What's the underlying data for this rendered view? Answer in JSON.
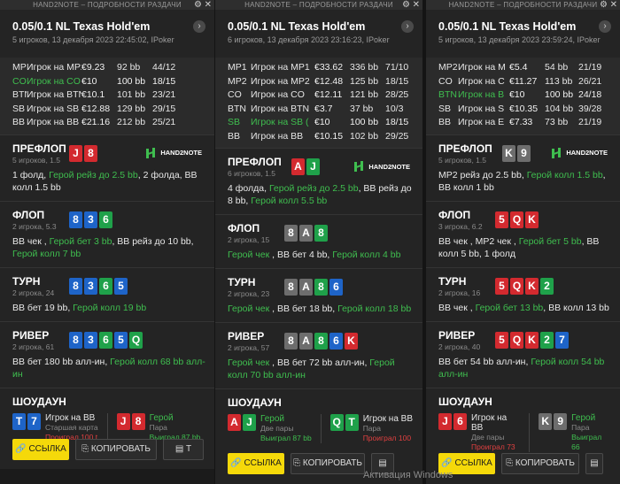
{
  "title_bar": "HAND2NOTE – ПОДРОБНОСТИ РАЗДАЧИ",
  "watermark": "Активация Windows",
  "logo_text": "HAND2NOTE",
  "labels": {
    "preflop": "ПРЕФЛОП",
    "flop": "ФЛОП",
    "turn": "ТУРН",
    "river": "РИВЕР",
    "showdown": "ШОУДАУН",
    "link": "ССЫЛКА",
    "copy": "КОПИРОВАТЬ"
  },
  "windows": [
    {
      "game": "0.05/0.1 NL Texas Hold'em",
      "sub": "5 игроков, 13 декабря 2023 22:45:02, IPoker",
      "players": [
        {
          "pos": "MP2",
          "name": "Игрок на MP2",
          "amt": "€9.23",
          "bb": "92 bb",
          "stat": "44/12"
        },
        {
          "pos": "CO",
          "name": "Игрок на CO (П",
          "amt": "€10",
          "bb": "100 bb",
          "stat": "18/15"
        },
        {
          "pos": "BTN",
          "name": "Игрок на BTN",
          "amt": "€10.1",
          "bb": "101 bb",
          "stat": "23/21"
        },
        {
          "pos": "SB",
          "name": "Игрок на SB",
          "amt": "€12.88",
          "bb": "129 bb",
          "stat": "29/15"
        },
        {
          "pos": "BB",
          "name": "Игрок на BB",
          "amt": "€21.16",
          "bb": "212 bb",
          "stat": "25/21"
        }
      ],
      "preflop": {
        "sub": "5 игроков, 1.5",
        "cards": [
          {
            "r": "J",
            "c": "red"
          },
          {
            "r": "8",
            "c": "red"
          }
        ],
        "a1": "1 фолд, ",
        "a2": "Герой рейз до 2.5 bb",
        "a3": ", 2 фолда, BB ",
        "a4": "колл",
        "a5": " 1.5 bb"
      },
      "flop": {
        "sub": "2 игрока, 5.3",
        "cards": [
          {
            "r": "8",
            "c": "blue"
          },
          {
            "r": "3",
            "c": "blue"
          },
          {
            "r": "6",
            "c": "grn"
          }
        ],
        "a1": "BB чек , ",
        "a2": "Герой бет 3 bb",
        "a3": ", BB рейз до 10 bb, ",
        "a4": "Герой колл 7 bb"
      },
      "turn": {
        "sub": "2 игрока, 24",
        "cards": [
          {
            "r": "8",
            "c": "blue"
          },
          {
            "r": "3",
            "c": "blue"
          },
          {
            "r": "6",
            "c": "grn"
          },
          {
            "r": "5",
            "c": "blue"
          }
        ],
        "a1": "BB бет 19 bb, ",
        "a2": "Герой колл 19 bb"
      },
      "river": {
        "sub": "2 игрока, 61",
        "cards": [
          {
            "r": "8",
            "c": "blue"
          },
          {
            "r": "3",
            "c": "blue"
          },
          {
            "r": "6",
            "c": "grn"
          },
          {
            "r": "5",
            "c": "blue"
          },
          {
            "r": "Q",
            "c": "grn"
          }
        ],
        "a1": "BB бет 180 bb алл-ин, ",
        "a2": "Герой колл 68 bb алл-ин"
      },
      "sd": [
        {
          "cards": [
            {
              "r": "T",
              "c": "blue"
            },
            {
              "r": "7",
              "c": "blue"
            }
          ],
          "name": "Игрок на BB",
          "hand": "Старшая карта",
          "res": "Проиграл 100 t",
          "win": false
        },
        {
          "cards": [
            {
              "r": "J",
              "c": "red"
            },
            {
              "r": "8",
              "c": "red"
            }
          ],
          "name": "Герой",
          "hand": "Пара",
          "res": "Выиграл 87 bb",
          "win": true
        }
      ],
      "third_btn": "T"
    },
    {
      "game": "0.05/0.1 NL Texas Hold'em",
      "sub": "6 игроков, 13 декабря 2023 23:16:23, IPoker",
      "players": [
        {
          "pos": "MP1",
          "name": "Игрок на MP1",
          "amt": "€33.62",
          "bb": "336 bb",
          "stat": "71/10"
        },
        {
          "pos": "MP2",
          "name": "Игрок на MP2",
          "amt": "€12.48",
          "bb": "125 bb",
          "stat": "18/15"
        },
        {
          "pos": "CO",
          "name": "Игрок на CO",
          "amt": "€12.11",
          "bb": "121 bb",
          "stat": "28/25"
        },
        {
          "pos": "BTN",
          "name": "Игрок на BTN",
          "amt": "€3.7",
          "bb": "37 bb",
          "stat": "10/3"
        },
        {
          "pos": "SB",
          "name": "Игрок на SB (",
          "amt": "€10",
          "bb": "100 bb",
          "stat": "18/15"
        },
        {
          "pos": "BB",
          "name": "Игрок на BB",
          "amt": "€10.15",
          "bb": "102 bb",
          "stat": "29/25"
        }
      ],
      "preflop": {
        "sub": "6 игроков, 1.5",
        "cards": [
          {
            "r": "A",
            "c": "red"
          },
          {
            "r": "J",
            "c": "grn"
          }
        ],
        "a1": "4 фолда, ",
        "a2": "Герой рейз до 2.5 bb",
        "a3": ", BB рейз до 8 bb, ",
        "a4": "Герой колл 5.5 bb",
        "a5": ""
      },
      "flop": {
        "sub": "2 игрока, 15",
        "cards": [
          {
            "r": "8",
            "c": "gray"
          },
          {
            "r": "A",
            "c": "gray"
          },
          {
            "r": "8",
            "c": "grn"
          }
        ],
        "a1": "",
        "a2": "Герой чек",
        "a3": " , BB бет 4 bb, ",
        "a4": "Герой колл 4 bb"
      },
      "turn": {
        "sub": "2 игрока, 23",
        "cards": [
          {
            "r": "8",
            "c": "gray"
          },
          {
            "r": "A",
            "c": "gray"
          },
          {
            "r": "8",
            "c": "grn"
          },
          {
            "r": "6",
            "c": "blue"
          }
        ],
        "a1": "",
        "a2": "Герой чек",
        "a3": " , BB бет 18 bb, ",
        "a4": "Герой колл 18 bb"
      },
      "river": {
        "sub": "2 игрока, 57",
        "cards": [
          {
            "r": "8",
            "c": "gray"
          },
          {
            "r": "A",
            "c": "gray"
          },
          {
            "r": "8",
            "c": "grn"
          },
          {
            "r": "6",
            "c": "blue"
          },
          {
            "r": "K",
            "c": "red"
          }
        ],
        "a1": "",
        "a2": "Герой чек",
        "a3": " , BB бет 72 bb алл-ин, ",
        "a4": "Герой колл 70 bb алл-ин"
      },
      "sd": [
        {
          "cards": [
            {
              "r": "A",
              "c": "red"
            },
            {
              "r": "J",
              "c": "grn"
            }
          ],
          "name": "Герой",
          "hand": "Две пары",
          "res": "Выиграл 87 bb",
          "win": true
        },
        {
          "cards": [
            {
              "r": "Q",
              "c": "grn"
            },
            {
              "r": "T",
              "c": "grn"
            }
          ],
          "name": "Игрок на BB",
          "hand": "Пара",
          "res": "Проиграл 100",
          "win": false
        }
      ],
      "third_btn": ""
    },
    {
      "game": "0.05/0.1 NL Texas Hold'em",
      "sub": "5 игроков, 13 декабря 2023 23:59:24, IPoker",
      "players": [
        {
          "pos": "MP2",
          "name": "Игрок на M",
          "amt": "€5.4",
          "bb": "54 bb",
          "stat": "21/19"
        },
        {
          "pos": "CO",
          "name": "Игрок на С",
          "amt": "€11.27",
          "bb": "113 bb",
          "stat": "26/21"
        },
        {
          "pos": "BTN",
          "name": "Игрок на B",
          "amt": "€10",
          "bb": "100 bb",
          "stat": "24/18"
        },
        {
          "pos": "SB",
          "name": "Игрок на S",
          "amt": "€10.35",
          "bb": "104 bb",
          "stat": "39/28"
        },
        {
          "pos": "BB",
          "name": "Игрок на Е",
          "amt": "€7.33",
          "bb": "73 bb",
          "stat": "21/19"
        }
      ],
      "preflop": {
        "sub": "5 игроков, 1.5",
        "cards": [
          {
            "r": "K",
            "c": "gray"
          },
          {
            "r": "9",
            "c": "gray"
          }
        ],
        "a1": "MP2 рейз до 2.5 bb, ",
        "a2": "Герой колл 1.5 bb",
        "a3": ", BB колл 1 bb",
        "a4": "",
        "a5": ""
      },
      "flop": {
        "sub": "3 игрока, 6.2",
        "cards": [
          {
            "r": "5",
            "c": "red"
          },
          {
            "r": "Q",
            "c": "red"
          },
          {
            "r": "K",
            "c": "red"
          }
        ],
        "a1": "BB чек , MP2 чек , ",
        "a2": "Герой бет 5 bb",
        "a3": ", BB колл 5 bb, 1 фолд",
        "a4": ""
      },
      "turn": {
        "sub": "2 игрока, 16",
        "cards": [
          {
            "r": "5",
            "c": "red"
          },
          {
            "r": "Q",
            "c": "red"
          },
          {
            "r": "K",
            "c": "red"
          },
          {
            "r": "2",
            "c": "grn"
          }
        ],
        "a1": "BB чек , ",
        "a2": "Герой бет 13 bb",
        "a3": ", BB колл 13 bb"
      },
      "river": {
        "sub": "2 игрока, 40",
        "cards": [
          {
            "r": "5",
            "c": "red"
          },
          {
            "r": "Q",
            "c": "red"
          },
          {
            "r": "K",
            "c": "red"
          },
          {
            "r": "2",
            "c": "grn"
          },
          {
            "r": "7",
            "c": "blue"
          }
        ],
        "a1": "BB бет 54 bb алл-ин, ",
        "a2": "Герой колл 54 bb алл-ин"
      },
      "sd": [
        {
          "cards": [
            {
              "r": "J",
              "c": "red"
            },
            {
              "r": "6",
              "c": "red"
            }
          ],
          "name": "Игрок на BB",
          "hand": "Две пары",
          "res": "Проиграл 73",
          "win": false
        },
        {
          "cards": [
            {
              "r": "K",
              "c": "gray"
            },
            {
              "r": "9",
              "c": "gray"
            }
          ],
          "name": "Герой",
          "hand": "Пара",
          "res": "Выиграл 66",
          "win": true
        }
      ],
      "third_btn": ""
    }
  ]
}
